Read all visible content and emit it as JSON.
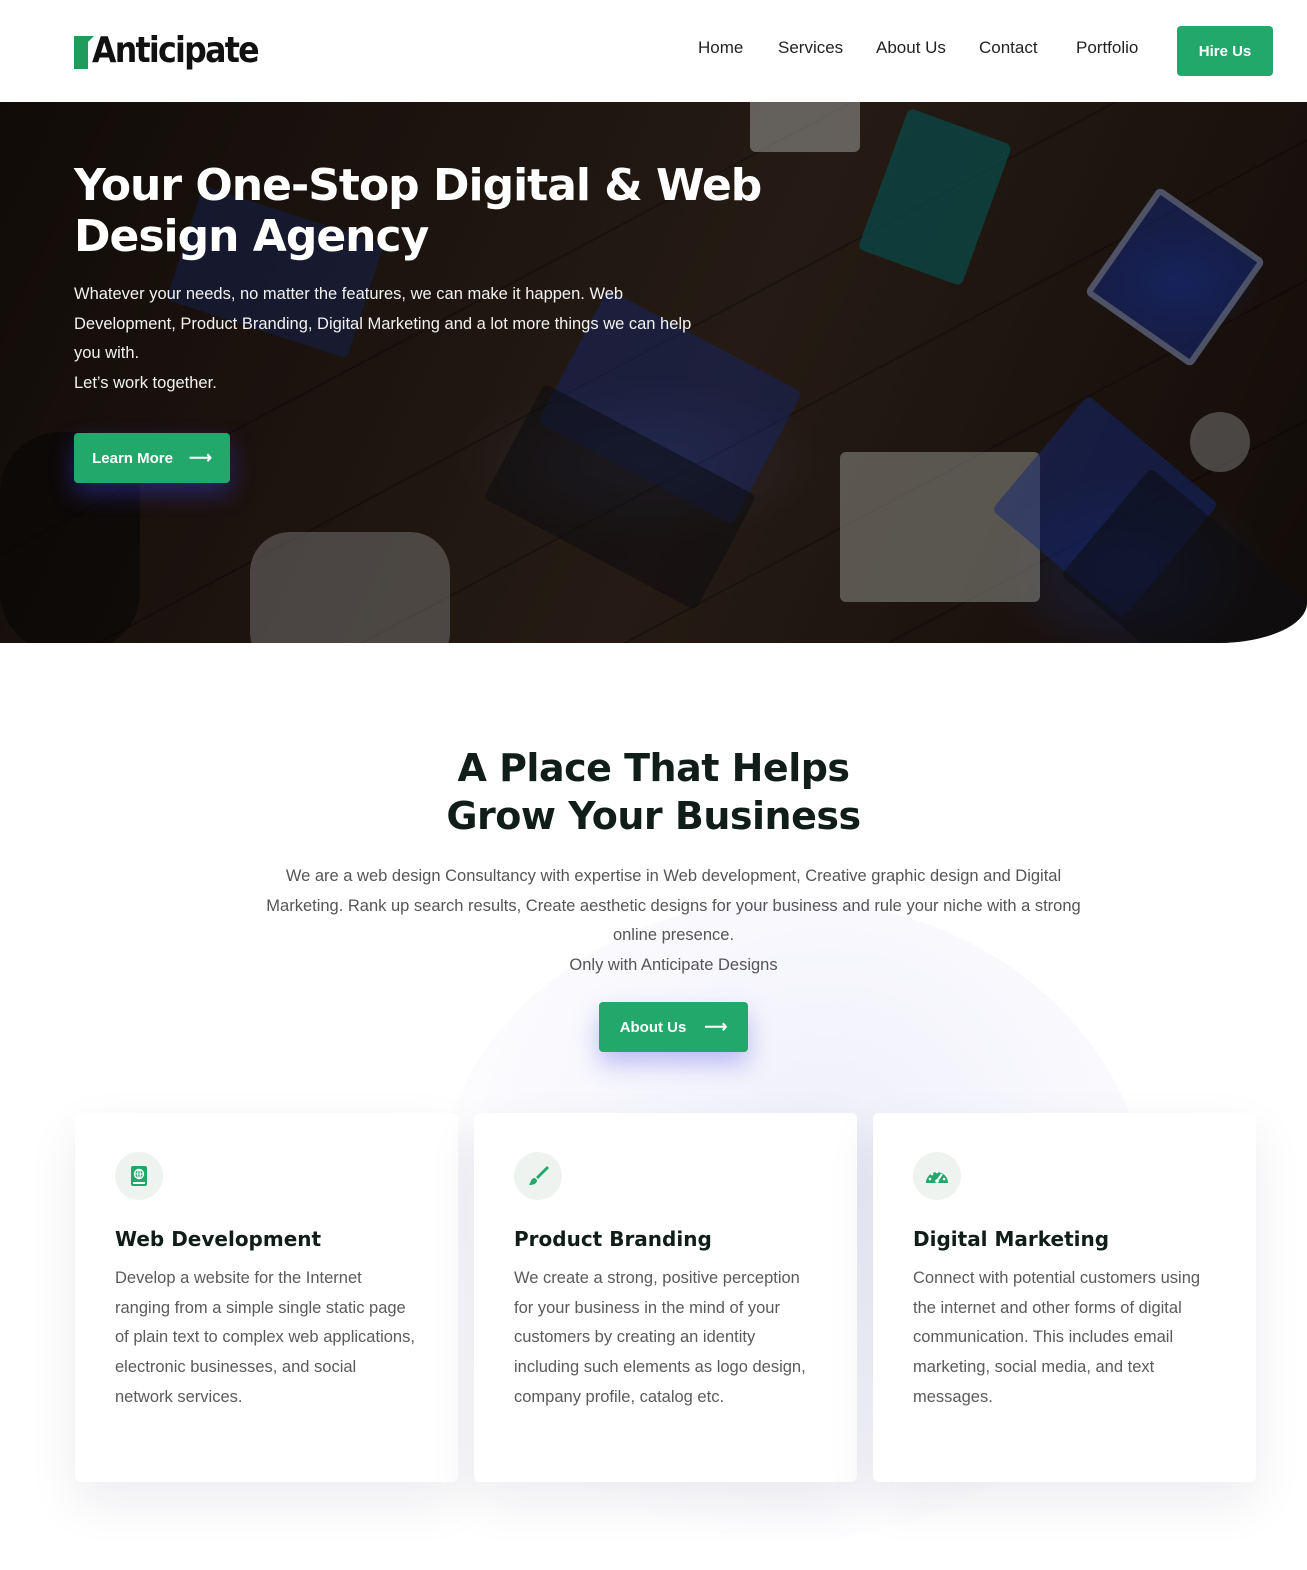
{
  "header": {
    "logo_text": "Anticipate",
    "nav": [
      "Home",
      "Services",
      "About Us",
      "Contact",
      "Portfolio"
    ],
    "cta_label": "Hire Us"
  },
  "hero": {
    "title": "Your One-Stop Digital & Web Design Agency",
    "description_1": "Whatever your needs, no matter the features, we can make it happen. Web Development, Product Branding, Digital Marketing and a lot more things we can help you with.",
    "description_2": "Let’s work together.",
    "button_label": "Learn More",
    "button_icon": "arrow-right-icon"
  },
  "about": {
    "title_line1": "A Place That Helps",
    "title_line2": "Grow Your Business",
    "description_1": "We are a web design Consultancy with expertise in Web development, Creative graphic design and Digital Marketing. Rank up search results, Create aesthetic designs for your business and rule your niche with a strong online presence.",
    "description_2": "Only with Anticipate Designs",
    "button_label": "About Us",
    "button_icon": "arrow-right-icon"
  },
  "services": [
    {
      "icon": "book-globe-icon",
      "title": "Web Development",
      "text": "Develop a website for the Internet ranging from a simple single static page of plain text to complex web applications, electronic businesses, and social network services."
    },
    {
      "icon": "paint-brush-icon",
      "title": "Product Branding",
      "text": "We create a strong, positive perception for your business in the mind of your customers by creating an identity including such elements as logo design, company profile, catalog etc."
    },
    {
      "icon": "speedometer-icon",
      "title": "Digital Marketing",
      "text": "Connect with potential customers using the internet and other forms of digital communication. This includes email marketing, social media, and text messages."
    }
  ],
  "colors": {
    "accent": "#22a86a",
    "heading": "#111d18",
    "body_text": "#5a5a5a"
  }
}
